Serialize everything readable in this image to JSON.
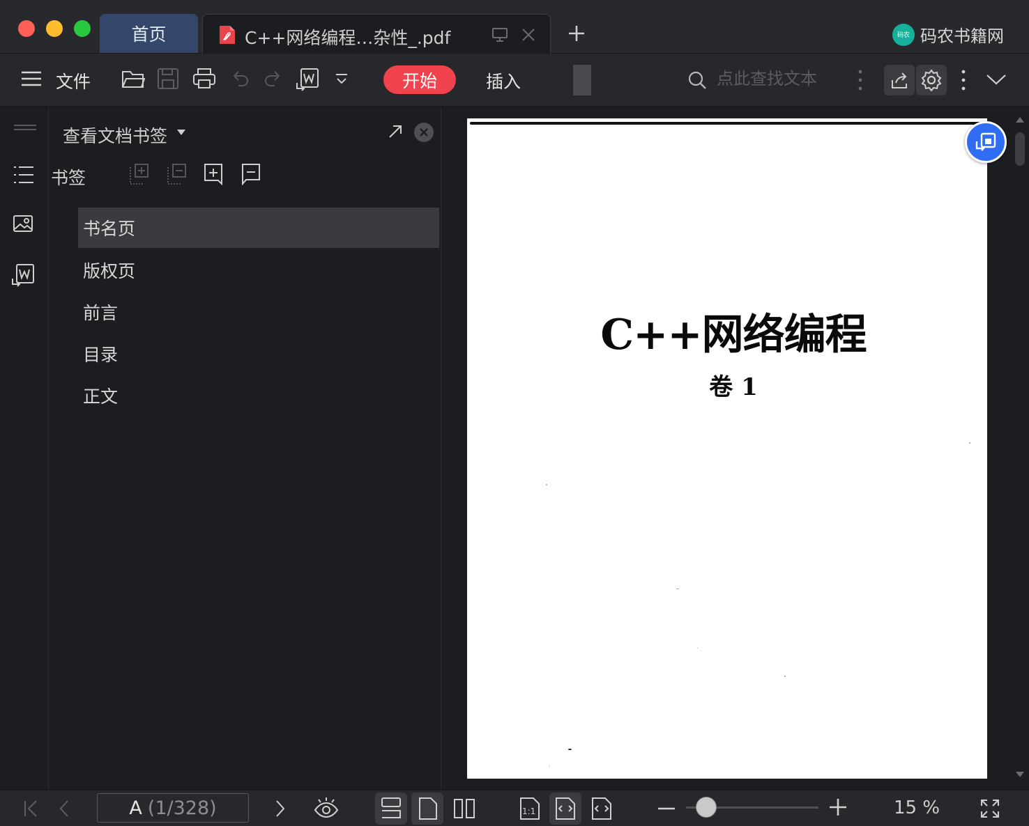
{
  "tabs": {
    "home_label": "首页",
    "doc_title": "C++网络编程…杂性_.pdf"
  },
  "site_brand": {
    "logo_text": "码农",
    "name": "码农书籍网"
  },
  "toolbar": {
    "file_label": "文件",
    "start_label": "开始",
    "insert_label": "插入",
    "search_placeholder": "点此查找文本"
  },
  "panel": {
    "title": "查看文档书签",
    "bookmark_label": "书签",
    "bookmarks": [
      "书名页",
      "版权页",
      "前言",
      "目录",
      "正文"
    ],
    "active_index": 0
  },
  "document": {
    "title": "C++网络编程",
    "volume": "卷 1"
  },
  "statusbar": {
    "page_current": "A",
    "page_total": "(1/328)",
    "zoom_label": "15 %",
    "zoom_level": 0.15
  },
  "colors": {
    "accent_start": "#f0434e",
    "float_button": "#2f6df5",
    "brand_logo": "#16b19a"
  }
}
